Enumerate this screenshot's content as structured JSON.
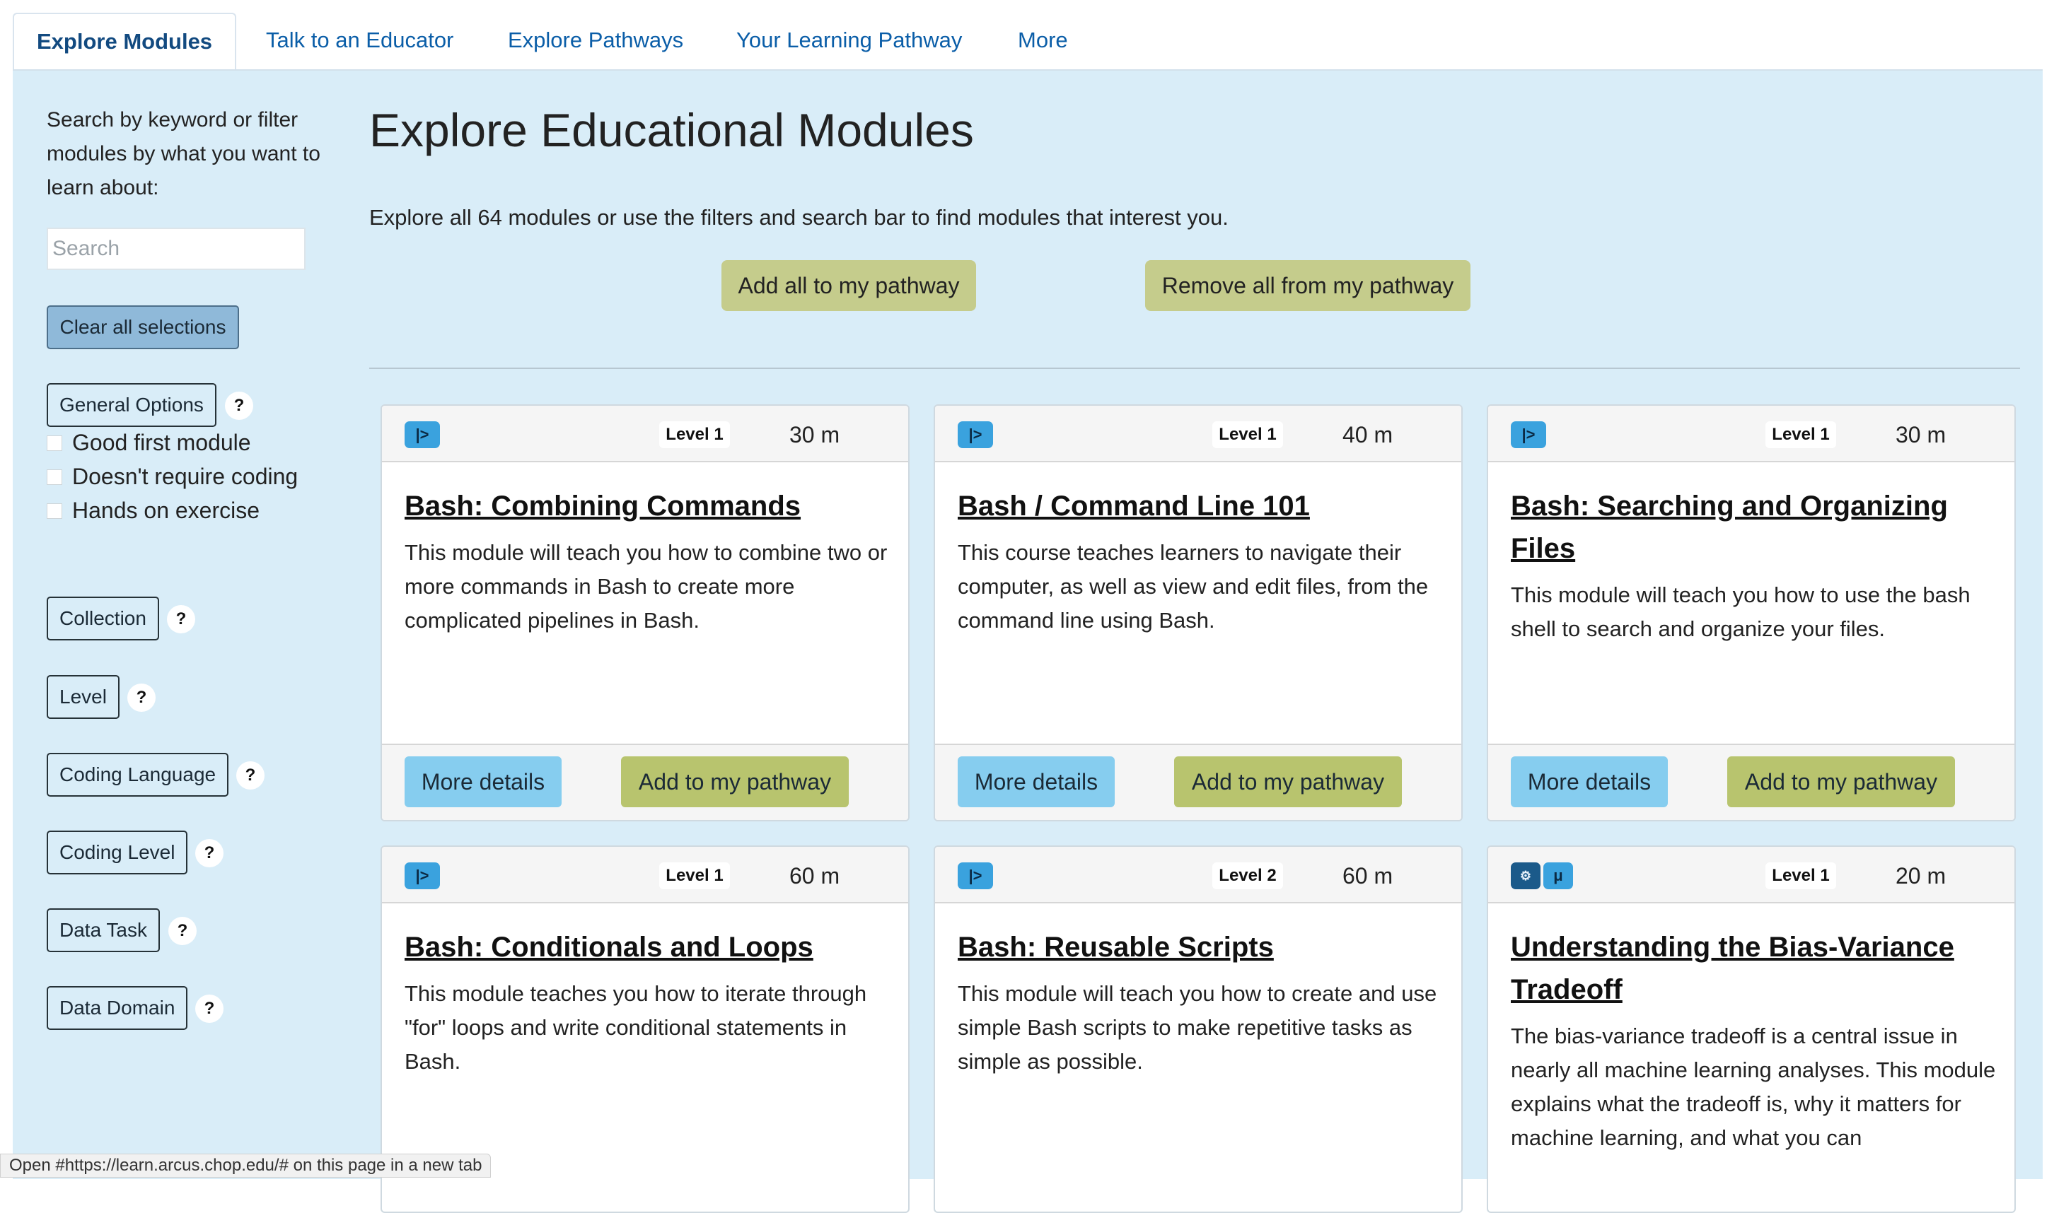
{
  "tabs": [
    "Explore Modules",
    "Talk to an Educator",
    "Explore Pathways",
    "Your Learning Pathway",
    "More"
  ],
  "sidebar": {
    "intro": "Search by keyword or filter modules by what you want to learn about:",
    "search_placeholder": "Search",
    "clear_label": "Clear all selections",
    "general_options": "General Options",
    "options": [
      "Good first module",
      "Doesn't require coding",
      "Hands on exercise"
    ],
    "filters": [
      "Collection",
      "Level",
      "Coding Language",
      "Coding Level",
      "Data Task",
      "Data Domain"
    ],
    "help": "?"
  },
  "main": {
    "title": "Explore Educational Modules",
    "subtitle": "Explore all 64 modules or use the filters and search bar to find modules that interest you.",
    "add_all": "Add all to my pathway",
    "remove_all": "Remove all from my pathway"
  },
  "cards": [
    {
      "icons": [
        "|>"
      ],
      "level": "Level 1",
      "duration": "30 m",
      "title": "Bash: Combining Commands",
      "description": "This module will teach you how to combine two or more commands in Bash to create more complicated pipelines in Bash.",
      "more": "More details",
      "add": "Add to my pathway"
    },
    {
      "icons": [
        "|>"
      ],
      "level": "Level 1",
      "duration": "40 m",
      "title": "Bash / Command Line 101",
      "description": "This course teaches learners to navigate their computer, as well as view and edit files, from the command line using Bash.",
      "more": "More details",
      "add": "Add to my pathway"
    },
    {
      "icons": [
        "|>"
      ],
      "level": "Level 1",
      "duration": "30 m",
      "title": "Bash: Searching and Organizing Files",
      "description": "This module will teach you how to use the bash shell to search and organize your files.",
      "more": "More details",
      "add": "Add to my pathway"
    },
    {
      "icons": [
        "|>"
      ],
      "level": "Level 1",
      "duration": "60 m",
      "title": "Bash: Conditionals and Loops",
      "description": "This module teaches you how to iterate through \"for\" loops and write conditional statements in Bash."
    },
    {
      "icons": [
        "|>"
      ],
      "level": "Level 2",
      "duration": "60 m",
      "title": "Bash: Reusable Scripts",
      "description": "This module will teach you how to create and use simple Bash scripts to make repetitive tasks as simple as possible."
    },
    {
      "icons": [
        "⚙",
        "μ"
      ],
      "level": "Level 1",
      "duration": "20 m",
      "title": "Understanding the Bias-Variance Tradeoff",
      "description": "The bias-variance tradeoff is a central issue in nearly all machine learning analyses. This module explains what the tradeoff is, why it matters for machine learning, and what you can"
    }
  ],
  "status_bar": "Open #https://learn.arcus.chop.edu/# on this page in a new tab",
  "colors": {
    "panel_bg": "#d9edf8",
    "tab_link": "#0b5ea8",
    "more_btn": "#86cdef",
    "add_btn": "#b8c46e",
    "pathway_btn": "#c5cc8c",
    "icon_bg": "#3aa2de"
  }
}
